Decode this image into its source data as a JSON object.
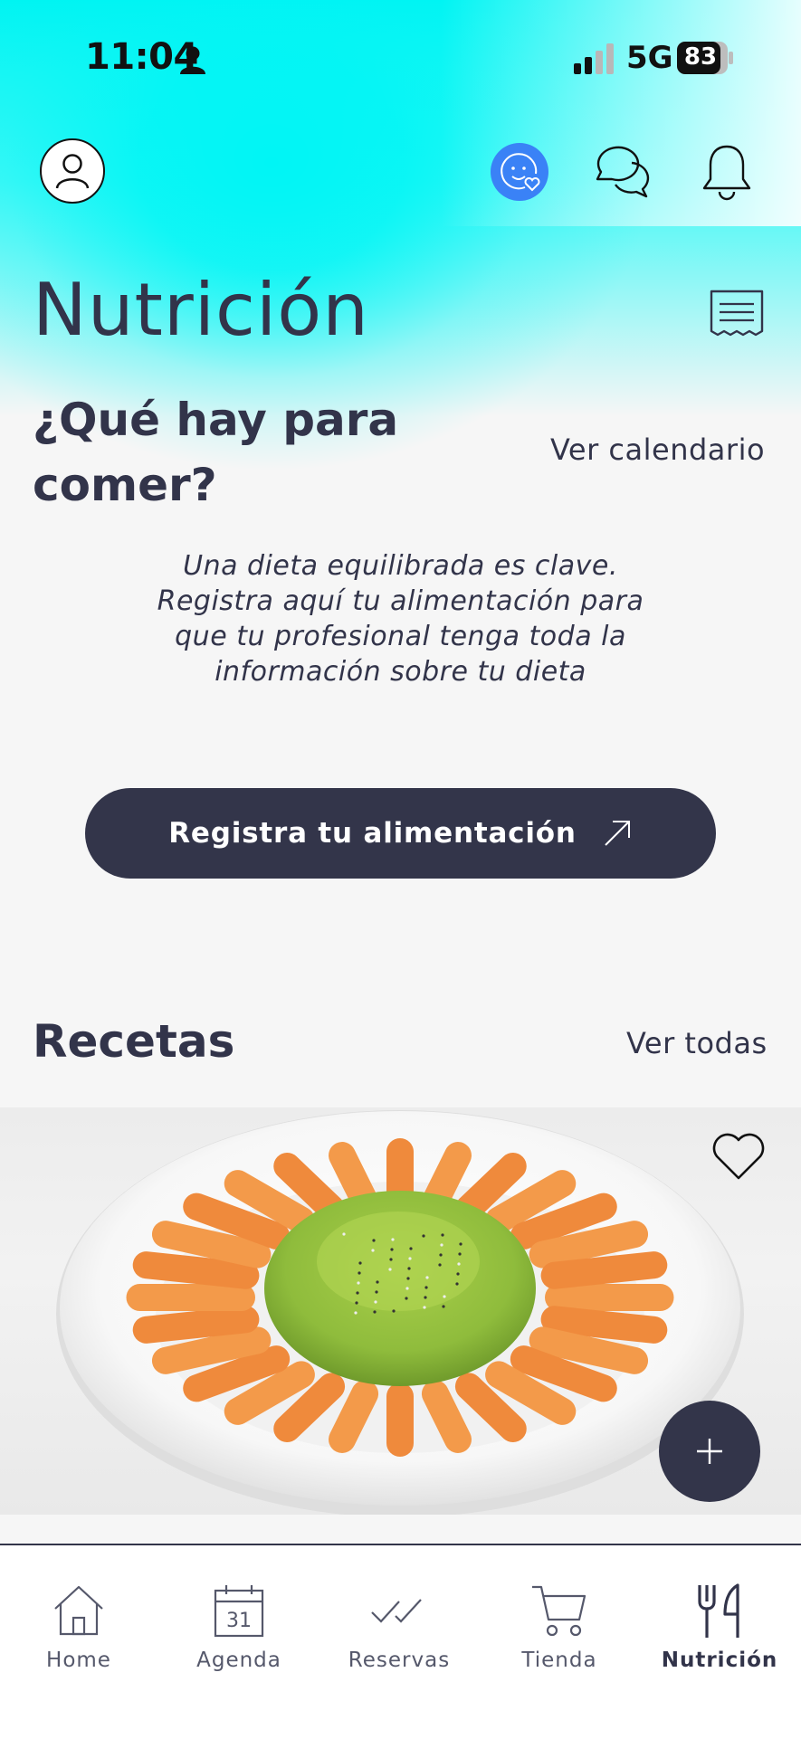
{
  "status_bar": {
    "time": "11:04",
    "network": "5G",
    "battery": "83"
  },
  "header": {
    "profile_icon": "user-icon",
    "mood_icon": "mood-heart-icon",
    "chat_icon": "chat-bubbles-icon",
    "notifications_icon": "bell-icon"
  },
  "page": {
    "title": "Nutrición",
    "receipt_icon": "receipt-icon"
  },
  "meals": {
    "heading": "¿Qué hay para comer?",
    "calendar_link": "Ver calendario",
    "intro": "Una dieta equilibrada es clave. Registra aquí tu alimentación para que tu profesional tenga toda la información sobre tu dieta",
    "cta_label": "Registra tu alimentación"
  },
  "recipes": {
    "heading": "Recetas",
    "see_all": "Ver todas"
  },
  "tabs": [
    {
      "label": "Home",
      "icon": "home-icon"
    },
    {
      "label": "Agenda",
      "icon": "calendar-icon",
      "day": "31"
    },
    {
      "label": "Reservas",
      "icon": "double-check-icon"
    },
    {
      "label": "Tienda",
      "icon": "cart-icon"
    },
    {
      "label": "Nutrición",
      "icon": "fork-knife-icon",
      "active": true
    }
  ],
  "colors": {
    "accent": "#00f4f2",
    "primary": "#33354a",
    "mood": "#3a82f6"
  }
}
